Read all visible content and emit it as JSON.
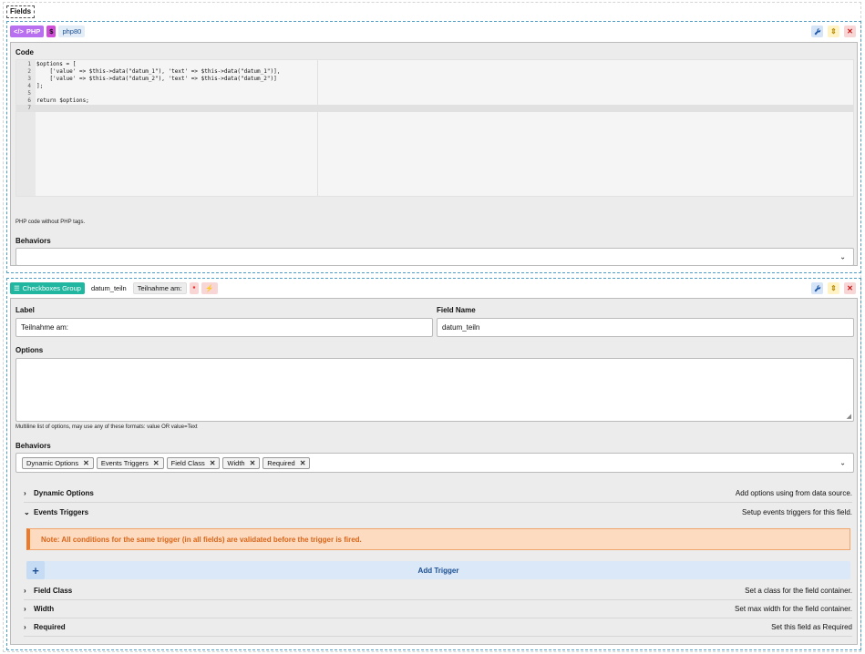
{
  "fields_tab": "Fields",
  "php_field": {
    "type_label": "PHP",
    "type_icon": "code-icon",
    "dollar_label": "$",
    "name_badge": "php80",
    "code_label": "Code",
    "code_lines": [
      "$options = [",
      "    ['value' => $this->data(\"datum_1\"), 'text' => $this->data(\"datum_1\")],",
      "    ['value' => $this->data(\"datum_2\"), 'text' => $this->data(\"datum_2\")]",
      "];",
      "",
      "return $options;",
      ""
    ],
    "line_numbers": [
      "1",
      "2",
      "3",
      "4",
      "5",
      "6",
      "7"
    ],
    "code_help": "PHP code without PHP tags.",
    "behaviors_label": "Behaviors"
  },
  "checkbox_field": {
    "type_label": "Checkboxes Group",
    "type_icon": "list-check-icon",
    "name_badge": "datum_teiln",
    "label_badge": "Teilnahme am:",
    "required_mark": "*",
    "events_mark": "⚡",
    "label_label": "Label",
    "label_value": "Teilnahme am:",
    "fieldname_label": "Field Name",
    "fieldname_value": "datum_teiln",
    "options_label": "Options",
    "options_help": "Multiline list of options, may use any of these formats: value OR value=Text",
    "behaviors_label": "Behaviors",
    "behavior_tags": [
      "Dynamic Options",
      "Events Triggers",
      "Field Class",
      "Width",
      "Required"
    ],
    "accordion": [
      {
        "title": "Dynamic Options",
        "desc": "Add options using from data source.",
        "open": false
      },
      {
        "title": "Events Triggers",
        "desc": "Setup events triggers for this field.",
        "open": true
      },
      {
        "title": "Field Class",
        "desc": "Set a class for the field container.",
        "open": false
      },
      {
        "title": "Width",
        "desc": "Set max width for the field container.",
        "open": false
      },
      {
        "title": "Required",
        "desc": "Set this field as Required",
        "open": false
      }
    ],
    "note": "Note: All conditions for the same trigger (in all fields) are validated before the trigger is fired.",
    "add_trigger_label": "Add Trigger",
    "add_trigger_plus": "+"
  },
  "controls": {
    "edit": "wrench-icon",
    "move": "move-icon",
    "delete": "close-icon"
  },
  "colors": {
    "php": "#b86ff0",
    "checkbox": "#20b6a0",
    "note_bg": "#fddbc0",
    "note_text": "#d8661a",
    "dashed_border": "#4c9ec7"
  }
}
